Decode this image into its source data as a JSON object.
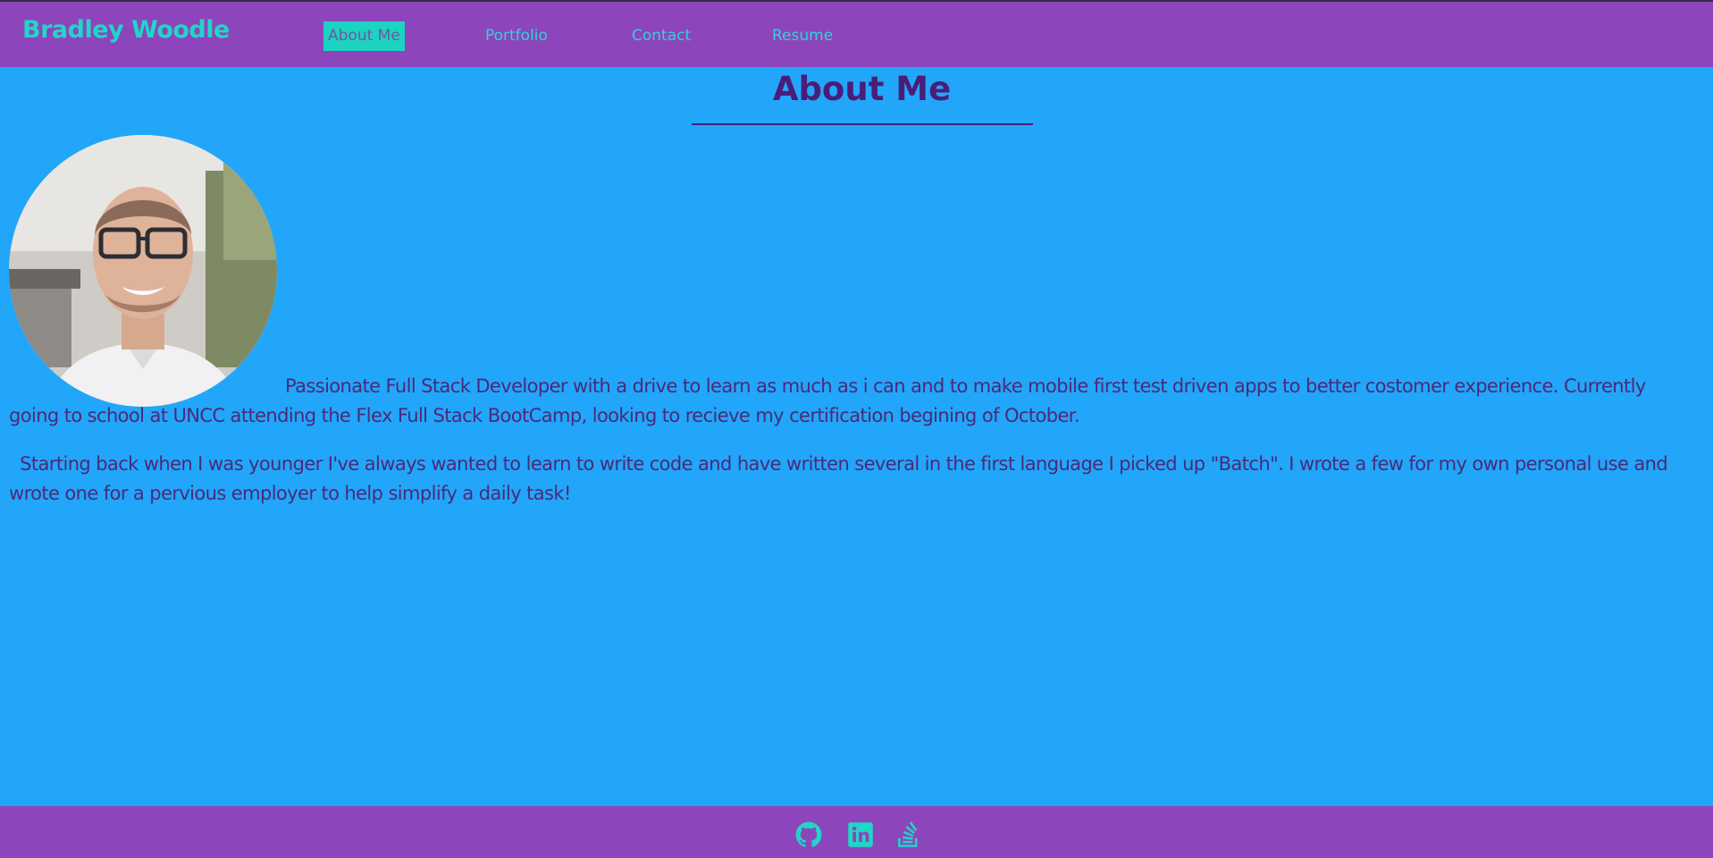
{
  "header": {
    "brand": "Bradley Woodle",
    "nav": [
      {
        "label": "About Me",
        "active": true
      },
      {
        "label": "Portfolio",
        "active": false
      },
      {
        "label": "Contact",
        "active": false
      },
      {
        "label": "Resume",
        "active": false
      }
    ]
  },
  "main": {
    "title": "About Me",
    "paragraphs": [
      "Passionate Full Stack Developer with a drive to learn as much as i can and to make mobile first test driven apps to better costomer experience. Currently going to school at UNCC attending the Flex Full Stack BootCamp, looking to recieve my certification begining of October.",
      "Starting back when I was younger I've always wanted to learn to write code and have written several in the first language I picked up \"Batch\". I wrote a few for my own personal use and wrote one for a pervious employer to help simplify a daily task!"
    ]
  },
  "footer": {
    "icons": [
      "github-icon",
      "linkedin-icon",
      "stack-overflow-icon"
    ]
  },
  "colors": {
    "nav_bg": "#8d45bb",
    "page_bg": "#22a6f9",
    "accent": "#1fd6c8",
    "text": "#4a2a7a"
  }
}
